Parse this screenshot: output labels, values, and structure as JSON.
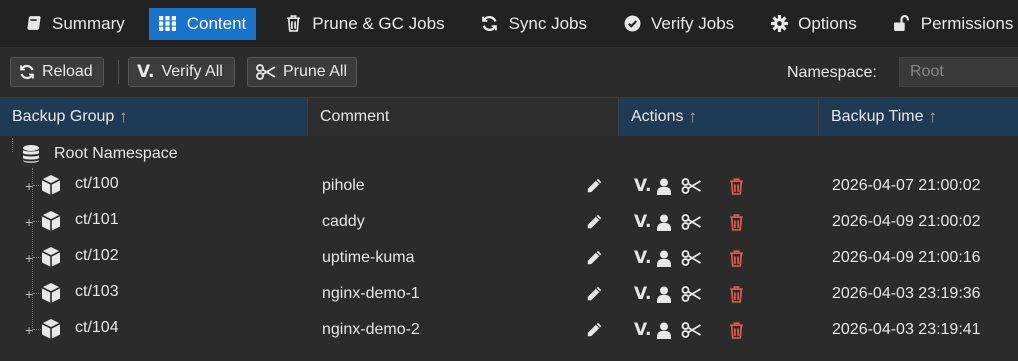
{
  "nav": {
    "tabs": [
      {
        "label": "Summary",
        "icon": "book-icon",
        "active": false
      },
      {
        "label": "Content",
        "icon": "grid-icon",
        "active": true
      },
      {
        "label": "Prune & GC Jobs",
        "icon": "trash-icon",
        "active": false
      },
      {
        "label": "Sync Jobs",
        "icon": "sync-icon",
        "active": false
      },
      {
        "label": "Verify Jobs",
        "icon": "check-circle-icon",
        "active": false
      },
      {
        "label": "Options",
        "icon": "gear-icon",
        "active": false
      },
      {
        "label": "Permissions",
        "icon": "unlock-icon",
        "active": false
      }
    ]
  },
  "toolbar": {
    "reload_label": "Reload",
    "verify_all_label": "Verify All",
    "prune_all_label": "Prune All",
    "namespace_label": "Namespace:",
    "namespace_value": "Root"
  },
  "grid": {
    "columns": [
      "Backup Group",
      "Comment",
      "Actions",
      "Backup Time"
    ],
    "root": {
      "label": "Root Namespace"
    },
    "rows": [
      {
        "group": "ct/100",
        "comment": "pihole",
        "time": "2026-04-07 21:00:02"
      },
      {
        "group": "ct/101",
        "comment": "caddy",
        "time": "2026-04-09 21:00:02"
      },
      {
        "group": "ct/102",
        "comment": "uptime-kuma",
        "time": "2026-04-09 21:00:16"
      },
      {
        "group": "ct/103",
        "comment": "nginx-demo-1",
        "time": "2026-04-03 23:19:36"
      },
      {
        "group": "ct/104",
        "comment": "nginx-demo-2",
        "time": "2026-04-03 23:19:41"
      }
    ]
  },
  "colors": {
    "accent": "#1a73c8",
    "sorted_header": "#1f3a55",
    "delete": "#e05a4e"
  }
}
